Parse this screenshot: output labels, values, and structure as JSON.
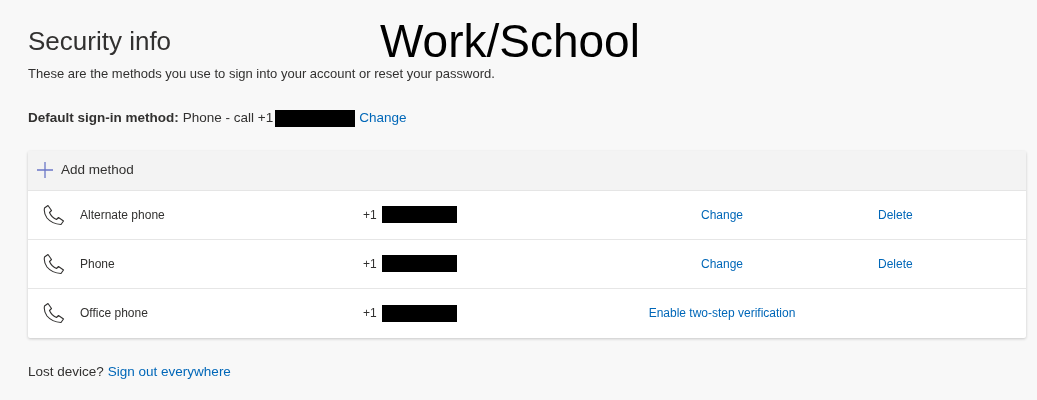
{
  "title": "Security info",
  "overlay_label": "Work/School",
  "description": "These are the methods you use to sign into your account or reset your password.",
  "default_method": {
    "label": "Default sign-in method:",
    "value": "Phone - call +1",
    "link": "Change"
  },
  "add_method": "Add method",
  "methods": [
    {
      "name": "Alternate phone",
      "number": "+1",
      "actions": [
        {
          "label": "Change",
          "kind": "primary"
        },
        {
          "label": "Delete",
          "kind": "secondary"
        }
      ]
    },
    {
      "name": "Phone",
      "number": "+1",
      "actions": [
        {
          "label": "Change",
          "kind": "primary"
        },
        {
          "label": "Delete",
          "kind": "secondary"
        }
      ]
    },
    {
      "name": "Office phone",
      "number": "+1",
      "actions": [
        {
          "label": "Enable two-step verification",
          "kind": "primary"
        }
      ]
    }
  ],
  "footer": {
    "text": "Lost device?",
    "link": "Sign out everywhere"
  }
}
